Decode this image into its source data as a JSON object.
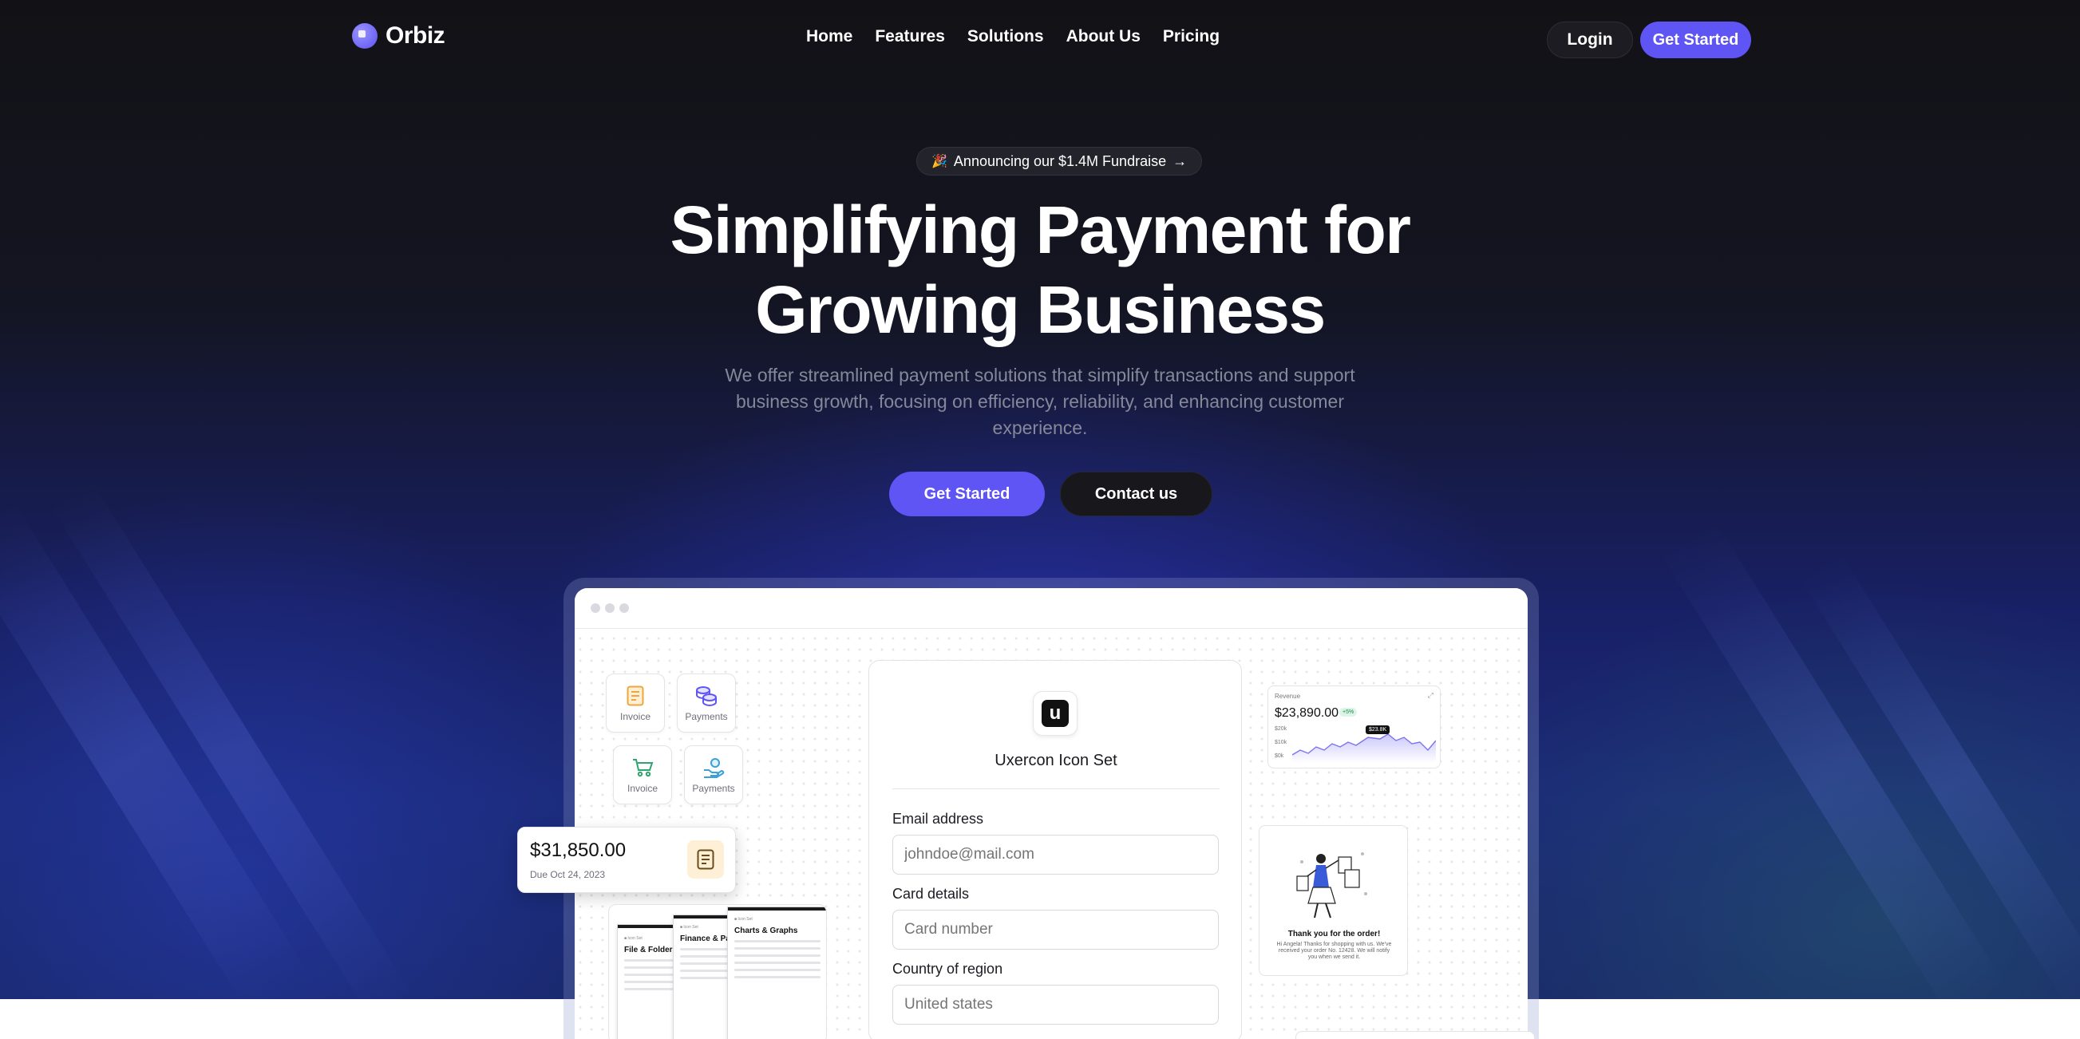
{
  "brand": {
    "name": "Orbiz"
  },
  "nav": {
    "items": [
      "Home",
      "Features",
      "Solutions",
      "About Us",
      "Pricing"
    ],
    "login": "Login",
    "cta": "Get Started"
  },
  "hero": {
    "announcement": "Announcing our $1.4M Fundraise",
    "title_line1": "Simplifying Payment for",
    "title_line2": "Growing Business",
    "subtitle": "We offer streamlined payment solutions that simplify transactions and support business growth, focusing on efficiency, reliability, and enhancing customer experience.",
    "primary_cta": "Get Started",
    "secondary_cta": "Contact us"
  },
  "mock": {
    "tiles": [
      {
        "label": "Invoice",
        "icon": "invoice-icon",
        "color": "#f0a63a"
      },
      {
        "label": "Payments",
        "icon": "coins-icon",
        "color": "#5f55f5"
      },
      {
        "label": "Invoice",
        "icon": "cart-icon",
        "color": "#2fa56e"
      },
      {
        "label": "Payments",
        "icon": "hand-coin-icon",
        "color": "#3aa0d6"
      }
    ],
    "form": {
      "title": "Uxercon Icon Set",
      "logo_letter": "u",
      "email_label": "Email address",
      "email_placeholder": "johndoe@mail.com",
      "card_label": "Card details",
      "card_placeholder": "Card number",
      "country_label": "Country of region",
      "country_value": "United states"
    },
    "invoice": {
      "amount": "$31,850.00",
      "due": "Due Oct 24, 2023"
    },
    "docs": {
      "card1": "File & Folder",
      "card2": "Finance & Pa",
      "card3": "Charts & Graphs"
    },
    "revenue": {
      "label": "Revenue",
      "value": "$23,890.00",
      "change": "+5%",
      "tooltip": "$23.8K",
      "y_ticks": [
        "$20k",
        "$10k",
        "$0k"
      ]
    },
    "order": {
      "title": "Thank you for the order!",
      "body": "Hi Angela! Thanks for shopping with us. We've received your order No. 12428. We will notify you when we send it."
    }
  },
  "colors": {
    "accent": "#5f55f5",
    "background": "#121216"
  }
}
